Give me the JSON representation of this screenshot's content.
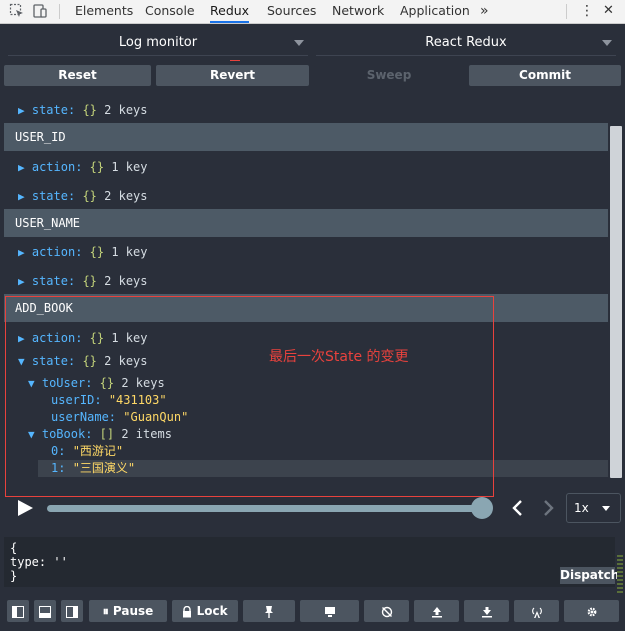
{
  "devtools_tabs": [
    "Elements",
    "Console",
    "Redux",
    "Sources",
    "Network",
    "Application"
  ],
  "active_tab": "Redux",
  "more_tabs": "»",
  "menu_icon": "⋮",
  "close_icon": "✕",
  "monitor_select": "Log monitor",
  "store_select": "React Redux",
  "buttons": {
    "reset": "Reset",
    "revert": "Revert",
    "sweep": "Sweep",
    "commit": "Commit"
  },
  "log": {
    "row0": {
      "key": "state:",
      "brace": "{}",
      "count": "2 keys"
    },
    "user_id": {
      "header": "USER_ID",
      "action": {
        "key": "action:",
        "brace": "{}",
        "count": "1 key"
      },
      "state": {
        "key": "state:",
        "brace": "{}",
        "count": "2 keys"
      }
    },
    "user_name": {
      "header": "USER_NAME",
      "action": {
        "key": "action:",
        "brace": "{}",
        "count": "1 key"
      },
      "state": {
        "key": "state:",
        "brace": "{}",
        "count": "2 keys"
      }
    },
    "add_book": {
      "header": "ADD_BOOK",
      "action": {
        "key": "action:",
        "brace": "{}",
        "count": "1 key"
      },
      "state": {
        "key": "state:",
        "brace": "{}",
        "count": "2 keys"
      },
      "to_user": {
        "key": "toUser:",
        "brace": "{}",
        "count": "2 keys"
      },
      "user_id_key": "userID:",
      "user_id_val": "\"431103\"",
      "user_name_key": "userName:",
      "user_name_val": "\"GuanQun\"",
      "to_book": {
        "key": "toBook:",
        "brace": "[]",
        "count": "2 items"
      },
      "item0_key": "0:",
      "item0_val": "\"西游记\"",
      "item1_key": "1:",
      "item1_val": "\"三国演义\""
    }
  },
  "annotation_note": "最后一次State 的变更",
  "speed": "1x",
  "dispatcher": {
    "line1": "{",
    "line2": "type: ''",
    "line3": "}",
    "button": "Dispatch"
  },
  "toolbar": {
    "pause": "Pause",
    "lock": "Lock"
  },
  "colors": {
    "accent_blue": "#55b6ff",
    "annotation_red": "#e8423d",
    "panel_bg": "#2a2f3a",
    "header_bg": "#4d5a66"
  }
}
